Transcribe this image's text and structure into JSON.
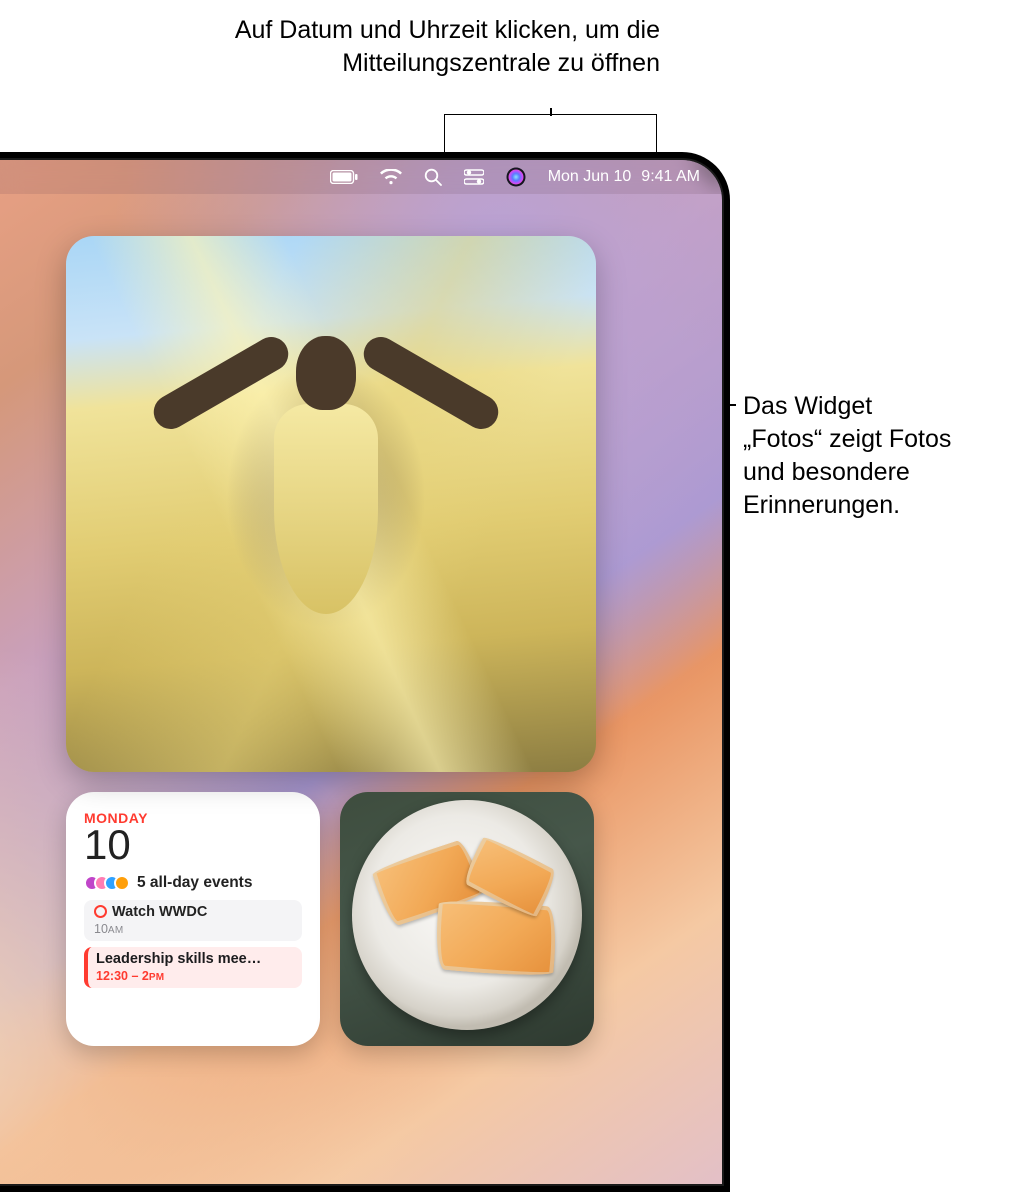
{
  "callouts": {
    "top": "Auf Datum und Uhrzeit klicken, um die Mitteilungszentrale zu öffnen",
    "right_l1": "Das Widget",
    "right_l2": "„Fotos“ zeigt Fotos",
    "right_l3": "und besondere",
    "right_l4": "Erinnerungen."
  },
  "menubar": {
    "date": "Mon Jun 10",
    "time": "9:41 AM"
  },
  "calendar": {
    "dayname": "MONDAY",
    "daynum": "10",
    "allday_text": "5 all-day events",
    "events": [
      {
        "title": "Watch WWDC",
        "time_label": "10",
        "ampm": "AM"
      },
      {
        "title": "Leadership skills mee…",
        "time_label": "12:30 – 2",
        "ampm": "PM"
      }
    ]
  },
  "icons": {
    "battery": "battery-icon",
    "wifi": "wifi-icon",
    "search": "search-icon",
    "control_center": "control-center-icon",
    "siri": "siri-icon"
  }
}
